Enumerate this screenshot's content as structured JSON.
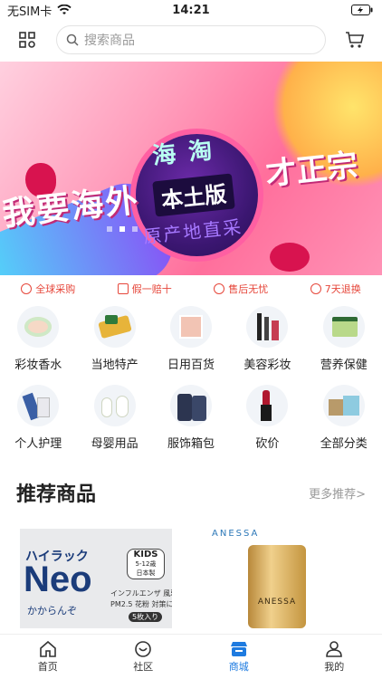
{
  "status_bar": {
    "carrier": "无SIM卡",
    "time": "14:21"
  },
  "header": {
    "scan_icon": "scan-icon",
    "search_placeholder": "搜索商品",
    "cart_icon": "cart-icon"
  },
  "banner": {
    "text_left": "我要海外",
    "text_top": "海淘",
    "text_center": "本土版",
    "text_right": "才正宗",
    "text_bottom": "原产地直采",
    "page_count": 3,
    "active_page": 1
  },
  "features": [
    {
      "label": "全球采购",
      "icon": "globe-icon"
    },
    {
      "label": "假一赔十",
      "icon": "receipt-icon"
    },
    {
      "label": "售后无忧",
      "icon": "service-icon"
    },
    {
      "label": "7天退换",
      "icon": "return-icon"
    }
  ],
  "categories": [
    {
      "label": "彩妆香水"
    },
    {
      "label": "当地特产"
    },
    {
      "label": "日用百货"
    },
    {
      "label": "美容彩妆"
    },
    {
      "label": "营养保健"
    },
    {
      "label": "个人护理"
    },
    {
      "label": "母婴用品"
    },
    {
      "label": "服饰箱包"
    },
    {
      "label": "砍价"
    },
    {
      "label": "全部分类"
    }
  ],
  "recommend": {
    "title": "推荐商品",
    "more": "更多推荐>"
  },
  "products": [
    {
      "brand_text": "ハイラック",
      "logo": "Neo",
      "sub": "かからんぞ",
      "badge": "KIDS",
      "badge_sub": "5-12歳",
      "badge_sub2": "日本製",
      "note1": "インフルエンザ 風邪",
      "note2": "PM2.5 花粉 対策に",
      "count": "5枚入り"
    },
    {
      "brand_text": "ANESSA",
      "bottle_text": "ANESSA"
    }
  ],
  "tabbar": [
    {
      "label": "首页",
      "icon": "home-icon"
    },
    {
      "label": "社区",
      "icon": "community-icon"
    },
    {
      "label": "商城",
      "icon": "shop-icon"
    },
    {
      "label": "我的",
      "icon": "user-icon"
    }
  ],
  "colors": {
    "accent": "#1e7be0",
    "feature_red": "#e6473b"
  }
}
